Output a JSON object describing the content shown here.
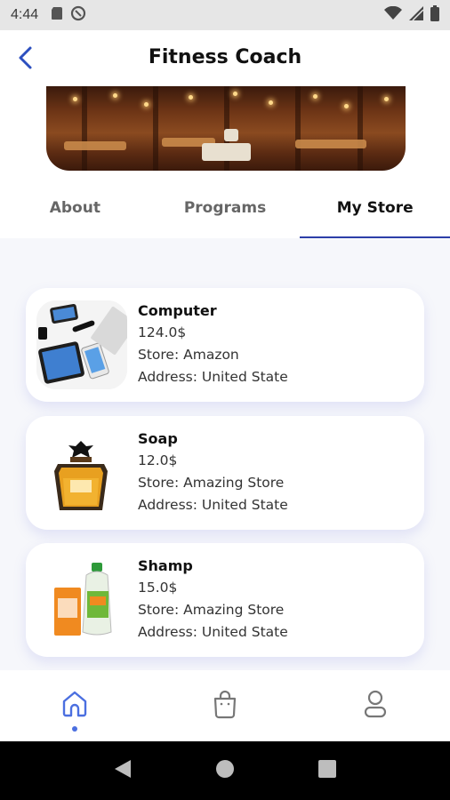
{
  "status_bar": {
    "time": "4:44",
    "left_icons": [
      "sd-card-icon",
      "data-saver-icon"
    ],
    "right_icons": [
      "wifi-icon",
      "signal-icon",
      "battery-icon"
    ]
  },
  "header": {
    "title": "Fitness Coach",
    "back_icon": "chevron-left-icon"
  },
  "tabs": [
    {
      "label": "About",
      "active": false
    },
    {
      "label": "Programs",
      "active": false
    },
    {
      "label": "My Store",
      "active": true
    }
  ],
  "products": [
    {
      "name": "Computer",
      "price": "124.0$",
      "store": "Store: Amazon",
      "address": "Address: United State",
      "image_icon": "devices-image"
    },
    {
      "name": "Soap",
      "price": "12.0$",
      "store": "Store: Amazing Store",
      "address": "Address: United State",
      "image_icon": "perfume-bottle-image"
    },
    {
      "name": "Shamp",
      "price": "15.0$",
      "store": "Store: Amazing Store",
      "address": "Address: United State",
      "image_icon": "shampoo-bottle-image"
    }
  ],
  "bottom_nav": {
    "items": [
      "home-icon",
      "shopping-bag-icon",
      "profile-icon"
    ],
    "active_index": 0
  },
  "system_nav": [
    "back-triangle-icon",
    "home-circle-icon",
    "recents-square-icon"
  ],
  "colors": {
    "accent": "#2c3ea8",
    "nav_active": "#4b6fe0",
    "content_bg": "#f6f7fb"
  }
}
